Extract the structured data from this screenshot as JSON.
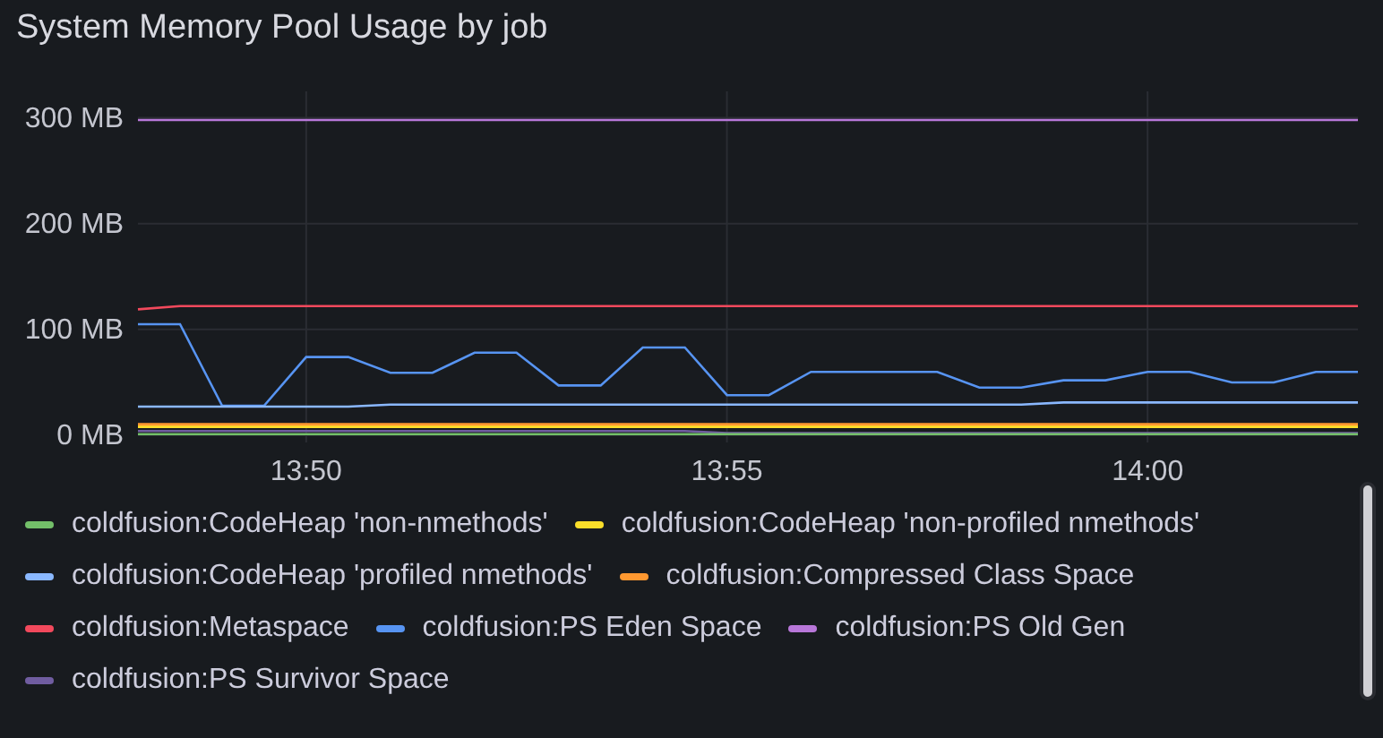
{
  "panel": {
    "title": "System Memory Pool Usage by job"
  },
  "chart_data": {
    "type": "line",
    "grid": true,
    "ylim": [
      0,
      325
    ],
    "yticks": [
      {
        "value": 0,
        "label": "0 MB"
      },
      {
        "value": 100,
        "label": "100 MB"
      },
      {
        "value": 200,
        "label": "200 MB"
      },
      {
        "value": 300,
        "label": "300 MB"
      }
    ],
    "categories": [
      null,
      null,
      null,
      null,
      "13:50",
      null,
      null,
      null,
      null,
      null,
      null,
      null,
      null,
      null,
      "13:55",
      null,
      null,
      null,
      null,
      null,
      null,
      null,
      null,
      null,
      "14:00",
      null,
      null,
      null,
      null,
      null
    ],
    "series": [
      {
        "name": "coldfusion:CodeHeap 'non-nmethods'",
        "color": "#73bf69",
        "values": [
          1,
          1,
          1,
          1,
          1,
          1,
          1,
          1,
          1,
          1,
          1,
          1,
          1,
          1,
          1,
          1,
          1,
          1,
          1,
          1,
          1,
          1,
          1,
          1,
          1,
          1,
          1,
          1,
          1,
          1
        ]
      },
      {
        "name": "coldfusion:CodeHeap 'non-profiled nmethods'",
        "color": "#fade2a",
        "values": [
          8,
          8,
          8,
          8,
          8,
          8,
          8,
          8,
          8,
          8,
          8,
          8,
          8,
          8,
          8,
          8,
          8,
          8,
          8,
          8,
          8,
          8,
          8,
          8,
          8,
          8,
          8,
          8,
          8,
          8
        ]
      },
      {
        "name": "coldfusion:CodeHeap 'profiled nmethods'",
        "color": "#8ab8ff",
        "values": [
          27,
          27,
          27,
          27,
          27,
          27,
          29,
          29,
          29,
          29,
          29,
          29,
          29,
          29,
          29,
          29,
          29,
          29,
          29,
          29,
          29,
          29,
          31,
          31,
          31,
          31,
          31,
          31,
          31,
          31
        ]
      },
      {
        "name": "coldfusion:Compressed Class Space",
        "color": "#ff9830",
        "values": [
          10,
          10,
          10,
          10,
          10,
          10,
          10,
          10,
          10,
          10,
          10,
          10,
          10,
          10,
          10,
          10,
          10,
          10,
          10,
          10,
          10,
          10,
          10,
          10,
          10,
          10,
          10,
          10,
          10,
          10
        ]
      },
      {
        "name": "coldfusion:Metaspace",
        "color": "#f2495c",
        "values": [
          119,
          122,
          122,
          122,
          122,
          122,
          122,
          122,
          122,
          122,
          122,
          122,
          122,
          122,
          122,
          122,
          122,
          122,
          122,
          122,
          122,
          122,
          122,
          122,
          122,
          122,
          122,
          122,
          122,
          122
        ]
      },
      {
        "name": "coldfusion:PS Eden Space",
        "color": "#5794f2",
        "values": [
          105,
          105,
          28,
          28,
          74,
          74,
          59,
          59,
          78,
          78,
          47,
          47,
          83,
          83,
          38,
          38,
          60,
          60,
          60,
          60,
          45,
          45,
          52,
          52,
          60,
          60,
          50,
          50,
          60,
          60
        ]
      },
      {
        "name": "coldfusion:PS Old Gen",
        "color": "#b877d9",
        "values": [
          298,
          298,
          298,
          298,
          298,
          298,
          298,
          298,
          298,
          298,
          298,
          298,
          298,
          298,
          298,
          298,
          298,
          298,
          298,
          298,
          298,
          298,
          298,
          298,
          298,
          298,
          298,
          298,
          298,
          298
        ]
      },
      {
        "name": "coldfusion:PS Survivor Space",
        "color": "#705da0",
        "values": [
          4,
          4,
          4,
          4,
          4,
          4,
          4,
          4,
          4,
          4,
          4,
          4,
          4,
          4,
          2,
          2,
          2,
          2,
          2,
          2,
          2,
          2,
          2,
          2,
          2,
          2,
          2,
          2,
          2,
          2
        ]
      }
    ]
  }
}
